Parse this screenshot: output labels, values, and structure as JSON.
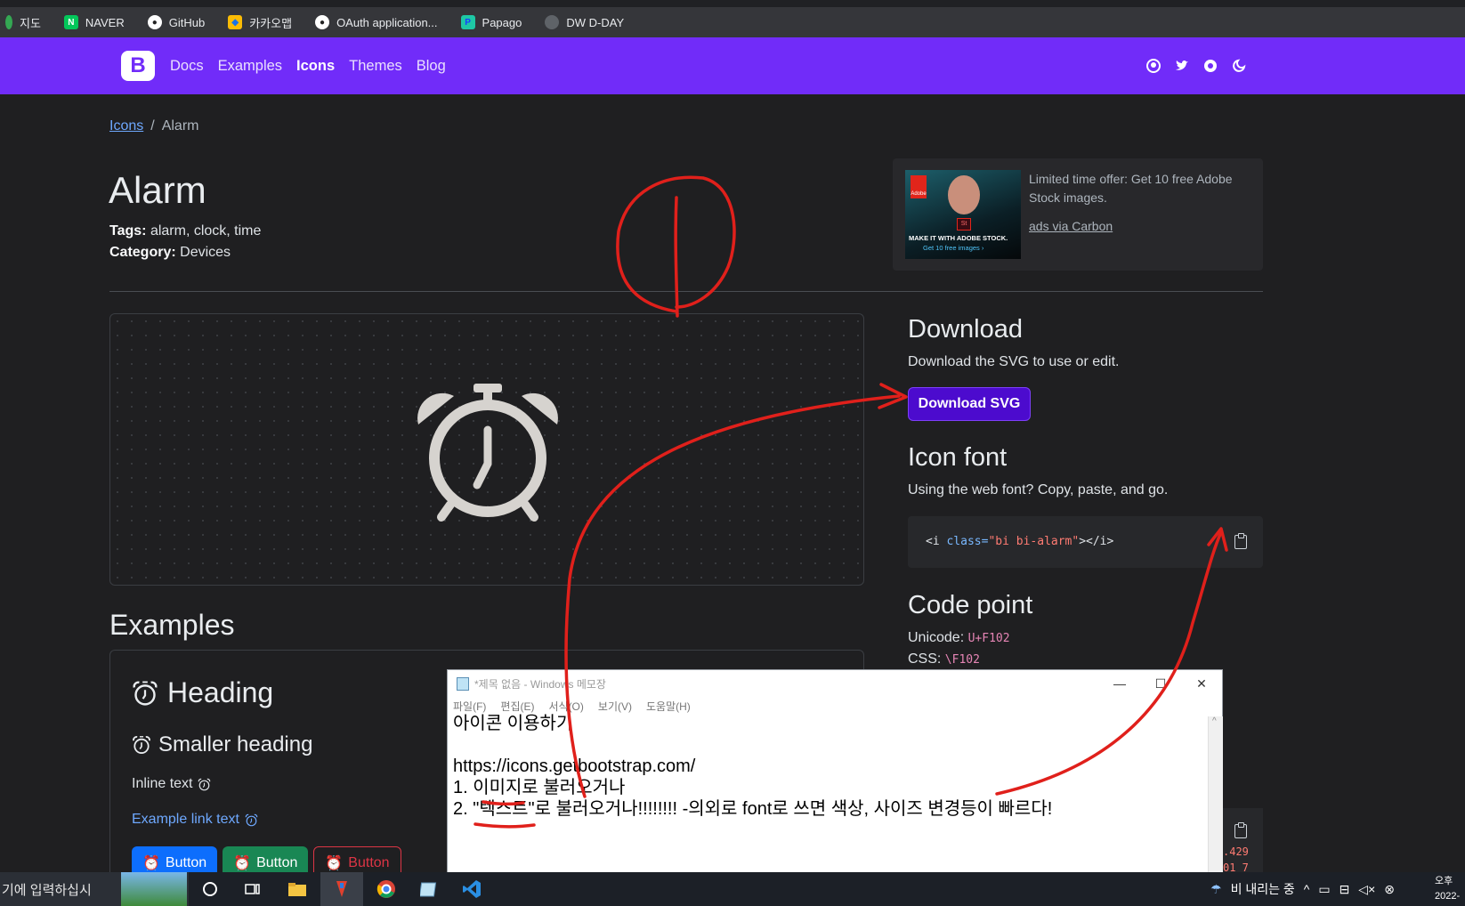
{
  "bookmarks": [
    {
      "label": "지도",
      "icon": "map-pin-icon",
      "color": "#34a853"
    },
    {
      "label": "NAVER",
      "icon": "naver-icon",
      "color": "#03c75a"
    },
    {
      "label": "GitHub",
      "icon": "github-icon",
      "color": "#ffffff"
    },
    {
      "label": "카카오맵",
      "icon": "kakaomap-icon",
      "color": "#fbbc05"
    },
    {
      "label": "OAuth application...",
      "icon": "github-icon",
      "color": "#ffffff"
    },
    {
      "label": "Papago",
      "icon": "papago-icon",
      "color": "#1ec8a5"
    },
    {
      "label": "DW D-DAY",
      "icon": "globe-icon",
      "color": "#9aa0a6"
    }
  ],
  "navbar": {
    "brand": "B",
    "links": [
      "Docs",
      "Examples",
      "Icons",
      "Themes",
      "Blog"
    ],
    "active": "Icons",
    "icons": [
      "github-icon",
      "twitter-icon",
      "opencollective-icon",
      "theme-toggle-icon"
    ],
    "color": "#712cf9"
  },
  "breadcrumb": {
    "parent": "Icons",
    "separator": "/",
    "current": "Alarm"
  },
  "icon": {
    "title": "Alarm",
    "tags_label": "Tags:",
    "tags": "alarm, clock, time",
    "category_label": "Category:",
    "category": "Devices"
  },
  "ad": {
    "image_line1": "MAKE IT WITH ADOBE STOCK.",
    "image_line2": "Get 10 free images ›",
    "image_badge": "St",
    "image_logo": "Adobe",
    "text": "Limited time offer: Get 10 free Adobe Stock images.",
    "via": "ads via Carbon"
  },
  "download": {
    "heading": "Download",
    "description": "Download the SVG to use or edit.",
    "button": "Download SVG"
  },
  "iconfont": {
    "heading": "Icon font",
    "description": "Using the web font? Copy, paste, and go.",
    "code_open": "<i ",
    "code_attr": "class=",
    "code_value": "\"bi bi-alarm\"",
    "code_close": "></i>"
  },
  "codepoint": {
    "heading": "Code point",
    "unicode_label": "Unicode:",
    "unicode_value": "U+F102",
    "css_label": "CSS:",
    "css_value": "\\F102",
    "partial_1": ".429",
    "partial_2": "01 7"
  },
  "examples": {
    "heading": "Examples",
    "h1": "Heading",
    "h2": "Smaller heading",
    "inline": "Inline text",
    "link": "Example link text",
    "buttons": [
      "Button",
      "Button",
      "Button"
    ]
  },
  "notepad": {
    "title": "*제목 없음 - Windows 메모장",
    "menu": [
      "파일(F)",
      "편집(E)",
      "서식(O)",
      "보기(V)",
      "도움말(H)"
    ],
    "lines": [
      "아이콘 이용하기",
      "",
      "https://icons.getbootstrap.com/",
      "1. 이미지로 불러오거나",
      "2. \"텍스트\"로 불러오거나!!!!!!!! -의외로 font로 쓰면 색상, 사이즈 변경등이 빠르다!"
    ]
  },
  "taskbar": {
    "search": "기에 입력하십시",
    "weather": "비 내리는 중",
    "clock_line1": "오후",
    "clock_line2": "2022-"
  },
  "annotation_color": "#e0201b"
}
